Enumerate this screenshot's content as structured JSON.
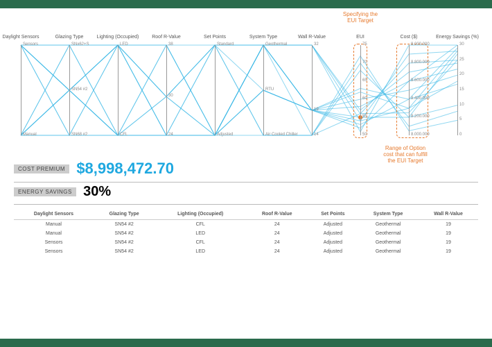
{
  "annotations": {
    "eui_target": "Specifying the\nEUI Target",
    "cost_range": "Range of Option\ncost that can fulfill\nthe EUI Target"
  },
  "metrics": {
    "cost_premium_label": "COST PREMIUM",
    "cost_premium_value": "$8,998,472.70",
    "energy_savings_label": "ENERGY SAVINGS",
    "energy_savings_value": "30%"
  },
  "chart_data": {
    "type": "parallel-coordinates",
    "axes": [
      {
        "name": "Daylight Sensors",
        "kind": "cat",
        "categories": [
          "Sensors",
          "Manual"
        ]
      },
      {
        "name": "Glazing Type",
        "kind": "cat",
        "categories": [
          "SNx62+S",
          "SN54 #2",
          "SN68 #2"
        ]
      },
      {
        "name": "Lighting (Occupied)",
        "kind": "cat",
        "categories": [
          "LED",
          "CFL"
        ]
      },
      {
        "name": "Roof R-Value",
        "kind": "num",
        "min": 24,
        "max": 38,
        "ticks": [
          24,
          30,
          38
        ]
      },
      {
        "name": "Set Points",
        "kind": "cat",
        "categories": [
          "Standard",
          "Adjusted"
        ]
      },
      {
        "name": "System Type",
        "kind": "cat",
        "categories": [
          "Geothermal",
          "RTU",
          "Air Cooled Chiller"
        ]
      },
      {
        "name": "Wall R-Value",
        "kind": "num",
        "min": 14,
        "max": 32,
        "ticks": [
          14,
          19,
          32
        ]
      },
      {
        "name": "EUI",
        "kind": "num",
        "min": 50,
        "max": 75,
        "ticks": [
          50,
          55,
          60,
          65,
          70,
          75
        ]
      },
      {
        "name": "Cost ($)",
        "kind": "num",
        "min": 8000000,
        "max": 9000000,
        "ticks": [
          8000000,
          8200000,
          8400000,
          8600000,
          8800000,
          9000000
        ],
        "fmt": "dot3"
      },
      {
        "name": "Energy Savings (%)",
        "kind": "num",
        "min": 0,
        "max": 30,
        "ticks": [
          0,
          5,
          10,
          15,
          20,
          25,
          30
        ]
      }
    ],
    "eui_target": 55,
    "lines": [
      {
        "v": [
          "Sensors",
          "SN54 #2",
          "CFL",
          24,
          "Adjusted",
          "Geothermal",
          19,
          53,
          8400000,
          29
        ]
      },
      {
        "v": [
          "Sensors",
          "SN54 #2",
          "LED",
          24,
          "Adjusted",
          "Geothermal",
          19,
          52,
          8600000,
          30
        ]
      },
      {
        "v": [
          "Manual",
          "SN54 #2",
          "CFL",
          24,
          "Adjusted",
          "Geothermal",
          19,
          55,
          8200000,
          27
        ]
      },
      {
        "v": [
          "Manual",
          "SN54 #2",
          "LED",
          24,
          "Adjusted",
          "Geothermal",
          19,
          54,
          8300000,
          28
        ]
      },
      {
        "v": [
          "Sensors",
          "SN68 #2",
          "CFL",
          30,
          "Standard",
          "Geothermal",
          32,
          57,
          8700000,
          24
        ]
      },
      {
        "v": [
          "Sensors",
          "SN68 #2",
          "LED",
          30,
          "Standard",
          "Geothermal",
          32,
          56,
          8800000,
          25
        ]
      },
      {
        "v": [
          "Manual",
          "SN68 #2",
          "CFL",
          24,
          "Standard",
          "Air Cooled Chiller",
          14,
          70,
          8100000,
          8
        ]
      },
      {
        "v": [
          "Manual",
          "SN68 #2",
          "LED",
          24,
          "Standard",
          "Air Cooled Chiller",
          14,
          68,
          8200000,
          10
        ]
      },
      {
        "v": [
          "Sensors",
          "SNx62+S",
          "CFL",
          38,
          "Adjusted",
          "RTU",
          19,
          60,
          8500000,
          20
        ]
      },
      {
        "v": [
          "Sensors",
          "SNx62+S",
          "LED",
          38,
          "Adjusted",
          "RTU",
          19,
          58,
          8600000,
          22
        ]
      },
      {
        "v": [
          "Manual",
          "SNx62+S",
          "CFL",
          24,
          "Adjusted",
          "Air Cooled Chiller",
          14,
          72,
          8050000,
          5
        ]
      },
      {
        "v": [
          "Manual",
          "SNx62+S",
          "LED",
          30,
          "Standard",
          "RTU",
          19,
          63,
          8400000,
          17
        ]
      },
      {
        "v": [
          "Sensors",
          "SN54 #2",
          "CFL",
          38,
          "Standard",
          "Geothermal",
          32,
          54,
          8900000,
          28
        ]
      },
      {
        "v": [
          "Sensors",
          "SN54 #2",
          "LED",
          38,
          "Adjusted",
          "Geothermal",
          32,
          51,
          9000000,
          30
        ]
      },
      {
        "v": [
          "Manual",
          "SN54 #2",
          "CFL",
          30,
          "Adjusted",
          "RTU",
          19,
          62,
          8300000,
          18
        ]
      },
      {
        "v": [
          "Manual",
          "SN54 #2",
          "LED",
          30,
          "Adjusted",
          "Geothermal",
          14,
          56,
          8250000,
          25
        ]
      }
    ]
  },
  "table": {
    "headers": [
      "Daylight Sensors",
      "Glazing Type",
      "Lighting (Occupied)",
      "Roof R-Value",
      "Set Points",
      "System Type",
      "Wall R-Value"
    ],
    "rows": [
      [
        "Manual",
        "SN54 #2",
        "CFL",
        "24",
        "Adjusted",
        "Geothermal",
        "19"
      ],
      [
        "Manual",
        "SN54 #2",
        "LED",
        "24",
        "Adjusted",
        "Geothermal",
        "19"
      ],
      [
        "Sensors",
        "SN54 #2",
        "CFL",
        "24",
        "Adjusted",
        "Geothermal",
        "19"
      ],
      [
        "Sensors",
        "SN54 #2",
        "LED",
        "24",
        "Adjusted",
        "Geothermal",
        "19"
      ]
    ]
  }
}
